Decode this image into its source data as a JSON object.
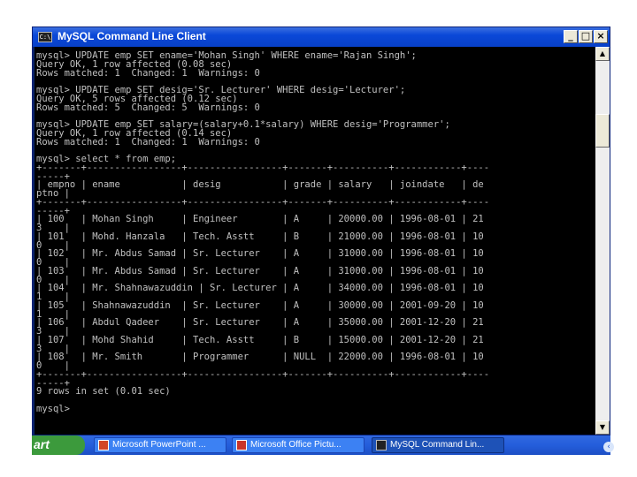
{
  "window": {
    "title": "MySQL Command Line Client",
    "buttons": {
      "minimize": "_",
      "maximize": "□",
      "close": "×"
    }
  },
  "console_lines": [
    "mysql> UPDATE emp SET ename='Mohan Singh' WHERE ename='Rajan Singh';",
    "Query OK, 1 row affected (0.08 sec)",
    "Rows matched: 1  Changed: 1  Warnings: 0",
    "",
    "mysql> UPDATE emp SET desig='Sr. Lecturer' WHERE desig='Lecturer';",
    "Query OK, 5 rows affected (0.12 sec)",
    "Rows matched: 5  Changed: 5  Warnings: 0",
    "",
    "mysql> UPDATE emp SET salary=(salary+0.1*salary) WHERE desig='Programmer';",
    "Query OK, 1 row affected (0.14 sec)",
    "Rows matched: 1  Changed: 1  Warnings: 0",
    "",
    "mysql> select * from emp;",
    "+-------+-----------------+-----------------+-------+----------+------------+----",
    "-----+",
    "| empno | ename           | desig           | grade | salary   | joindate   | de",
    "ptno |",
    "+-------+-----------------+-----------------+-------+----------+------------+----",
    "-----+",
    "| 100   | Mohan Singh     | Engineer        | A     | 20000.00 | 1996-08-01 | 21",
    "3    |",
    "| 101   | Mohd. Hanzala   | Tech. Asstt     | B     | 21000.00 | 1996-08-01 | 10",
    "0    |",
    "| 102   | Mr. Abdus Samad | Sr. Lecturer    | A     | 31000.00 | 1996-08-01 | 10",
    "0    |",
    "| 103   | Mr. Abdus Samad | Sr. Lecturer    | A     | 31000.00 | 1996-08-01 | 10",
    "0    |",
    "| 104   | Mr. Shahnawazuddin | Sr. Lecturer | A     | 34000.00 | 1996-08-01 | 10",
    "1    |",
    "| 105   | Shahnawazuddin  | Sr. Lecturer    | A     | 30000.00 | 2001-09-20 | 10",
    "1    |",
    "| 106   | Abdul Qadeer    | Sr. Lecturer    | A     | 35000.00 | 2001-12-20 | 21",
    "3    |",
    "| 107   | Mohd Shahid     | Tech. Asstt     | B     | 15000.00 | 2001-12-20 | 21",
    "3    |",
    "| 108   | Mr. Smith       | Programmer      | NULL  | 22000.00 | 1996-08-01 | 10",
    "0    |",
    "+-------+-----------------+-----------------+-------+----------+------------+----",
    "-----+",
    "9 rows in set (0.01 sec)",
    "",
    "mysql>"
  ],
  "scrollbar": {
    "up_arrow": "▲",
    "down_arrow": "▼"
  },
  "taskbar": {
    "start_label": "art",
    "tasks": [
      {
        "label": "Microsoft PowerPoint ...",
        "icon": "powerpoint-icon",
        "icon_color": "#d24726"
      },
      {
        "label": "Microsoft Office Pictu...",
        "icon": "picture-manager-icon",
        "icon_color": "#c8352b"
      },
      {
        "label": "MySQL Command Lin...",
        "icon": "console-icon",
        "icon_color": "#222222"
      }
    ]
  }
}
